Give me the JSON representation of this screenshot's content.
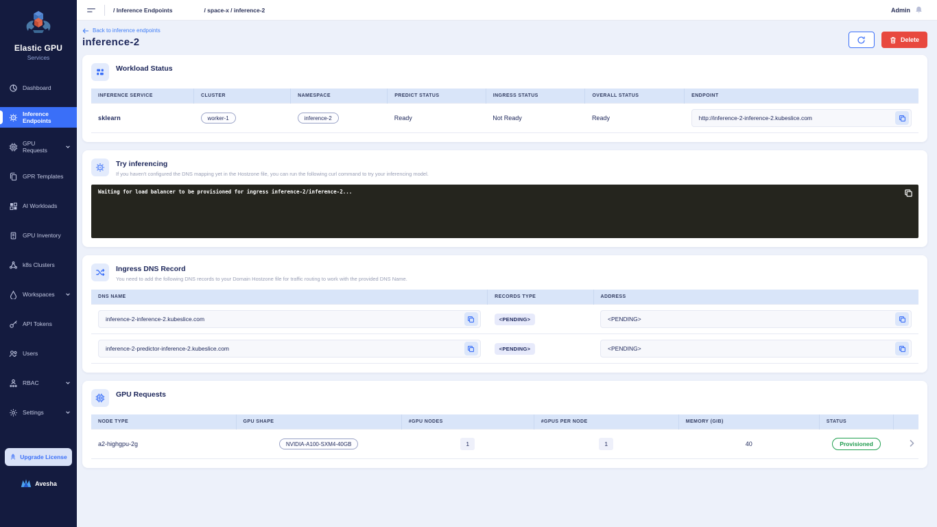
{
  "colors": {
    "accent": "#3a6ff8",
    "danger": "#e8483e",
    "success": "#1d9a4c",
    "sidebar_bg": "#141b3f",
    "terminal_bg": "#25251e",
    "table_header_bg": "#d9e5f9"
  },
  "sidebar": {
    "logo": {
      "title": "Elastic GPU",
      "subtitle": "Services"
    },
    "items": [
      {
        "label": "Dashboard"
      },
      {
        "label": "Inference Endpoints"
      },
      {
        "label": "GPU Requests"
      },
      {
        "label": "GPR Templates"
      },
      {
        "label": "AI Workloads"
      },
      {
        "label": "GPU Inventory"
      },
      {
        "label": "k8s Clusters"
      },
      {
        "label": "Workspaces"
      },
      {
        "label": "API Tokens"
      },
      {
        "label": "Users"
      },
      {
        "label": "RBAC"
      },
      {
        "label": "Settings"
      }
    ],
    "upgrade_label": "Upgrade License",
    "footer_brand": "Avesha"
  },
  "topbar": {
    "breadcrumb_section": "/  Inference Endpoints",
    "breadcrumb_path": "/ space-x / inference-2",
    "user": "Admin"
  },
  "header": {
    "back_link": "Back to inference endpoints",
    "title": "inference-2",
    "delete_label": "Delete"
  },
  "workload": {
    "title": "Workload Status",
    "columns": [
      "INFERENCE SERVICE",
      "CLUSTER",
      "NAMESPACE",
      "PREDICT STATUS",
      "INGRESS STATUS",
      "OVERALL STATUS",
      "ENDPOINT"
    ],
    "row": {
      "service": "sklearn",
      "cluster": "worker-1",
      "namespace": "inference-2",
      "predict_status": "Ready",
      "ingress_status": "Not Ready",
      "overall_status": "Ready",
      "endpoint": "http://inference-2-inference-2.kubeslice.com"
    }
  },
  "try_inferencing": {
    "title": "Try inferencing",
    "subtitle": "If you haven't configured the DNS mapping yet in the Hostzone file, you can run the following curl command to try your inferencing model.",
    "terminal_text": "Waiting for load balancer to be provisioned for ingress inference-2/inference-2..."
  },
  "ingress_dns": {
    "title": "Ingress DNS Record",
    "subtitle": "You need to add the following DNS records to your Domain Hostzone file for traffic routing to work with the provided DNS Name.",
    "columns": [
      "DNS NAME",
      "RECORDS TYPE",
      "ADDRESS"
    ],
    "rows": [
      {
        "dns_name": "inference-2-inference-2.kubeslice.com",
        "records_type": "<PENDING>",
        "address": "<PENDING>"
      },
      {
        "dns_name": "inference-2-predictor-inference-2.kubeslice.com",
        "records_type": "<PENDING>",
        "address": "<PENDING>"
      }
    ]
  },
  "gpu_requests": {
    "title": "GPU Requests",
    "columns": [
      "NODE TYPE",
      "GPU SHAPE",
      "#GPU NODES",
      "#GPUS PER NODE",
      "MEMORY (GIB)",
      "STATUS"
    ],
    "row": {
      "node_type": "a2-highgpu-2g",
      "gpu_shape": "NVIDIA-A100-SXM4-40GB",
      "gpu_nodes": "1",
      "gpus_per_node": "1",
      "memory": "40",
      "status": "Provisioned"
    }
  }
}
